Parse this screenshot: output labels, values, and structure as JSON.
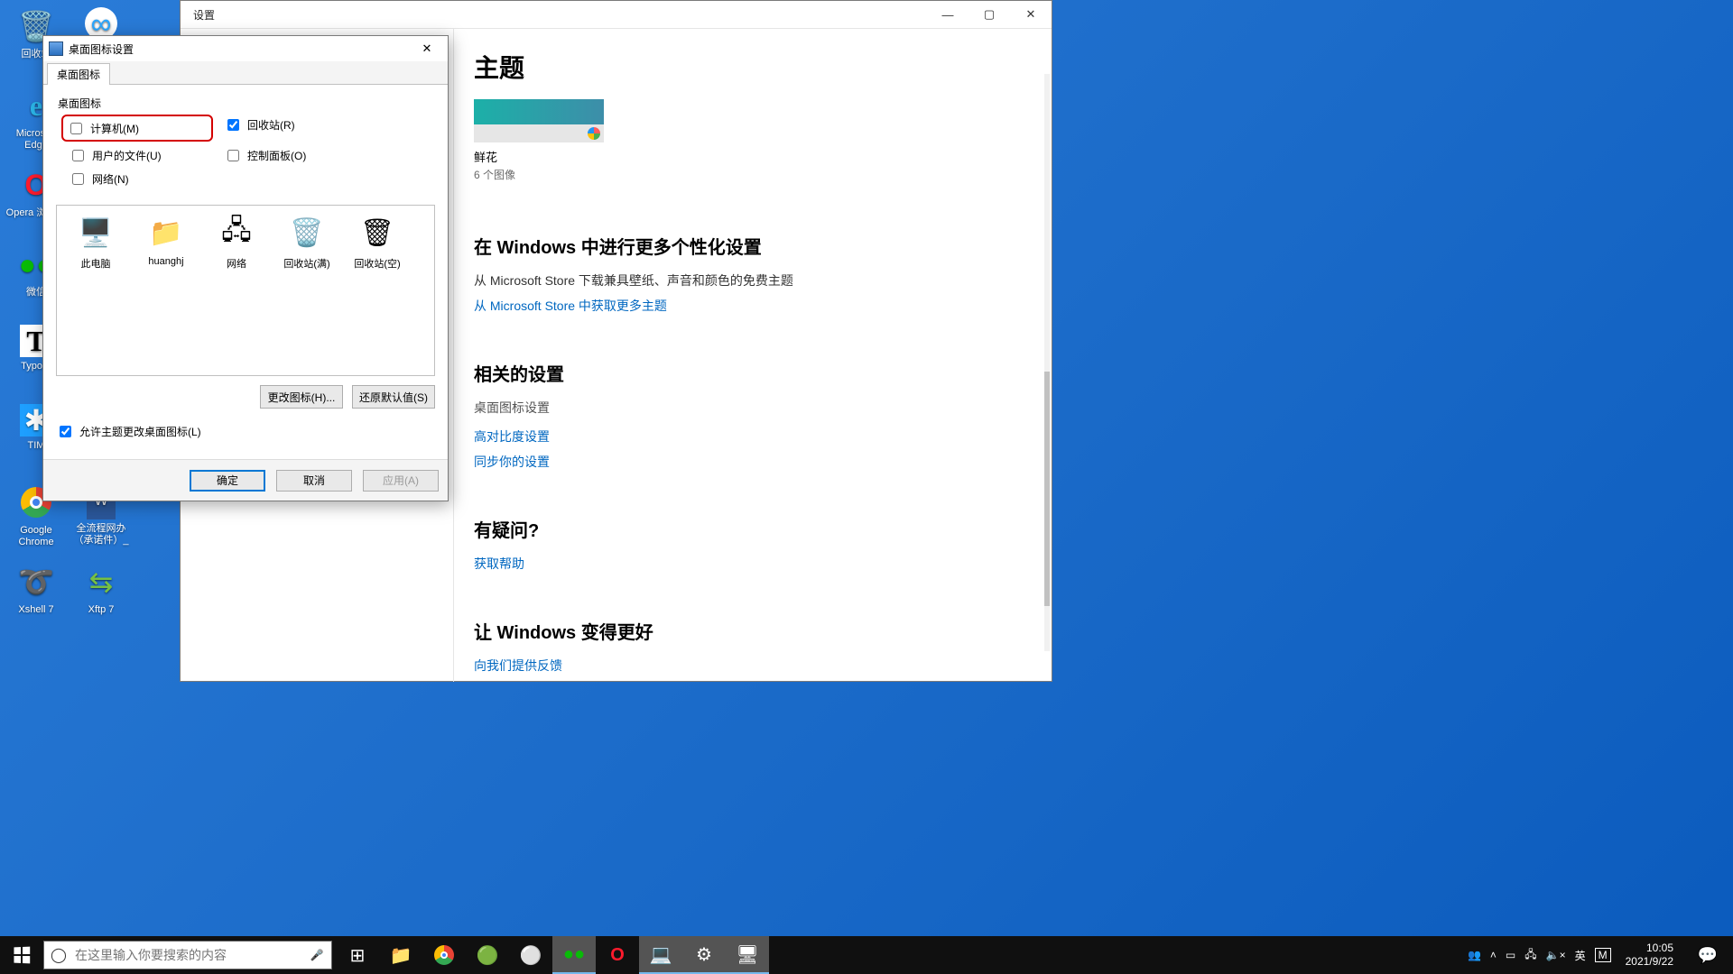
{
  "desktop": {
    "icons": [
      {
        "name": "recycle-bin",
        "label": "回收站",
        "glyph": "🗑"
      },
      {
        "name": "edge",
        "label": "Microsoft Edge",
        "glyph": "e"
      },
      {
        "name": "opera",
        "label": "Opera 浏览器",
        "glyph": "O"
      },
      {
        "name": "wechat",
        "label": "微信",
        "glyph": "💬"
      },
      {
        "name": "typora",
        "label": "Typora",
        "glyph": "T"
      },
      {
        "name": "tim",
        "label": "TIM",
        "glyph": "✱"
      },
      {
        "name": "chrome",
        "label": "Google Chrome",
        "glyph": "◎"
      },
      {
        "name": "xshell",
        "label": "Xshell 7",
        "glyph": "➰"
      },
      {
        "name": "baidu-netdisk",
        "label": "",
        "glyph": "∞"
      },
      {
        "name": "word-doc",
        "label": "全流程网办（承诺件）_",
        "glyph": "📄"
      },
      {
        "name": "xftp",
        "label": "Xftp 7",
        "glyph": "⇆"
      }
    ]
  },
  "settings": {
    "window_title": "设置",
    "heading": "主题",
    "theme_name": "鲜花",
    "theme_sub": "6 个图像",
    "more_h": "在 Windows 中进行更多个性化设置",
    "more_desc": "从 Microsoft Store 下载兼具壁纸、声音和颜色的免费主题",
    "more_link": "从 Microsoft Store 中获取更多主题",
    "related_h": "相关的设置",
    "related_desktop": "桌面图标设置",
    "related_contrast": "高对比度设置",
    "related_sync": "同步你的设置",
    "question_h": "有疑问?",
    "question_link": "获取帮助",
    "better_h": "让 Windows 变得更好",
    "better_link": "向我们提供反馈"
  },
  "dialog": {
    "title": "桌面图标设置",
    "tab": "桌面图标",
    "group": "桌面图标",
    "checks": {
      "computer": "计算机(M)",
      "recycle": "回收站(R)",
      "user": "用户的文件(U)",
      "control": "控制面板(O)",
      "network": "网络(N)"
    },
    "icons": [
      {
        "name": "this-pc",
        "label": "此电脑"
      },
      {
        "name": "user",
        "label": "huanghj"
      },
      {
        "name": "network",
        "label": "网络"
      },
      {
        "name": "recycle-full",
        "label": "回收站(满)"
      },
      {
        "name": "recycle-empty",
        "label": "回收站(空)"
      }
    ],
    "change_icon": "更改图标(H)...",
    "restore": "还原默认值(S)",
    "allow_theme": "允许主题更改桌面图标(L)",
    "ok": "确定",
    "cancel": "取消",
    "apply": "应用(A)"
  },
  "taskbar": {
    "search_placeholder": "在这里输入你要搜索的内容",
    "ime1": "英",
    "ime2": "M",
    "time": "10:05",
    "date": "2021/9/22"
  }
}
